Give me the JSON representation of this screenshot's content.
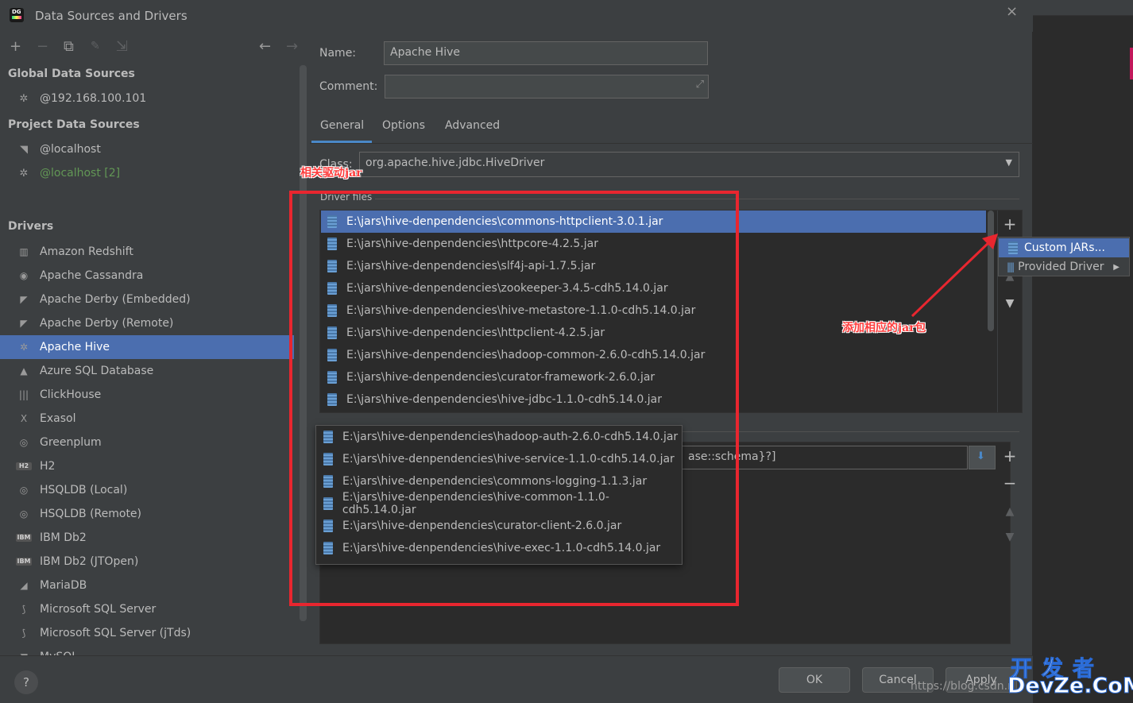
{
  "window": {
    "title": "Data Sources and Drivers",
    "close_label": "×"
  },
  "toolbar": {
    "add": "+",
    "remove": "−",
    "duplicate": "⧉",
    "settings": "🔧",
    "import": "⇲",
    "back": "←",
    "forward": "→"
  },
  "sidebar": {
    "global_title": "Global Data Sources",
    "global_items": [
      {
        "label": "@192.168.100.101",
        "icon": "hive-icon"
      }
    ],
    "project_title": "Project Data Sources",
    "project_items": [
      {
        "label": "@localhost",
        "icon": "mysql-icon"
      },
      {
        "label": "@localhost [2]",
        "icon": "hive-icon"
      }
    ],
    "drivers_title": "Drivers",
    "drivers": [
      {
        "label": "Amazon Redshift",
        "icon_text": "▥"
      },
      {
        "label": "Apache Cassandra",
        "icon_text": "◉"
      },
      {
        "label": "Apache Derby (Embedded)",
        "icon_text": "◤"
      },
      {
        "label": "Apache Derby (Remote)",
        "icon_text": "◤"
      },
      {
        "label": "Apache Hive",
        "icon_text": "✲"
      },
      {
        "label": "Azure SQL Database",
        "icon_text": "▲"
      },
      {
        "label": "ClickHouse",
        "icon_text": "|||"
      },
      {
        "label": "Exasol",
        "icon_text": "X"
      },
      {
        "label": "Greenplum",
        "icon_text": "◎"
      },
      {
        "label": "H2",
        "icon_text": "H2"
      },
      {
        "label": "HSQLDB (Local)",
        "icon_text": "◎"
      },
      {
        "label": "HSQLDB (Remote)",
        "icon_text": "◎"
      },
      {
        "label": "IBM Db2",
        "icon_text": "IBM"
      },
      {
        "label": "IBM Db2 (JTOpen)",
        "icon_text": "IBM"
      },
      {
        "label": "MariaDB",
        "icon_text": "◢"
      },
      {
        "label": "Microsoft SQL Server",
        "icon_text": "⟆"
      },
      {
        "label": "Microsoft SQL Server (jTds)",
        "icon_text": "⟆"
      },
      {
        "label": "MySQL",
        "icon_text": "◥"
      }
    ],
    "selected_driver": "Apache Hive"
  },
  "form": {
    "name_label": "Name:",
    "name_value": "Apache Hive",
    "comment_label": "Comment:",
    "comment_value": "",
    "tabs": [
      {
        "label": "General"
      },
      {
        "label": "Options"
      },
      {
        "label": "Advanced"
      }
    ],
    "class_label": "Class:",
    "class_value": "org.apache.hive.jdbc.HiveDriver",
    "driver_files_label": "Driver files",
    "url_template_tail": "ase::schema}?]"
  },
  "driver_files": [
    "E:\\jars\\hive-denpendencies\\commons-httpclient-3.0.1.jar",
    "E:\\jars\\hive-denpendencies\\httpcore-4.2.5.jar",
    "E:\\jars\\hive-denpendencies\\slf4j-api-1.7.5.jar",
    "E:\\jars\\hive-denpendencies\\zookeeper-3.4.5-cdh5.14.0.jar",
    "E:\\jars\\hive-denpendencies\\hive-metastore-1.1.0-cdh5.14.0.jar",
    "E:\\jars\\hive-denpendencies\\httpclient-4.2.5.jar",
    "E:\\jars\\hive-denpendencies\\hadoop-common-2.6.0-cdh5.14.0.jar",
    "E:\\jars\\hive-denpendencies\\curator-framework-2.6.0.jar",
    "E:\\jars\\hive-denpendencies\\hive-jdbc-1.1.0-cdh5.14.0.jar"
  ],
  "popup_files": [
    "E:\\jars\\hive-denpendencies\\hadoop-auth-2.6.0-cdh5.14.0.jar",
    "E:\\jars\\hive-denpendencies\\hive-service-1.1.0-cdh5.14.0.jar",
    "E:\\jars\\hive-denpendencies\\commons-logging-1.1.3.jar",
    "E:\\jars\\hive-denpendencies\\hive-common-1.1.0-cdh5.14.0.jar",
    "E:\\jars\\hive-denpendencies\\curator-client-2.6.0.jar",
    "E:\\jars\\hive-denpendencies\\hive-exec-1.1.0-cdh5.14.0.jar"
  ],
  "context_menu": {
    "items": [
      {
        "label": "Custom JARs..."
      },
      {
        "label": "Provided Driver"
      }
    ]
  },
  "buttons": {
    "ok": "OK",
    "cancel": "Cancel",
    "apply": "Apply",
    "help": "?"
  },
  "annotations": {
    "related_jars": "相关驱动jar",
    "add_jars": "添加相应的jar包"
  },
  "overlay": {
    "url_text": "https://blog.csdn.n",
    "watermark_line1": "开发者",
    "watermark_line2": "DevZe.CoM"
  },
  "colors": {
    "selection": "#4b6eaf",
    "annotation_red": "#e8262f",
    "tab_underline": "#4a88c7"
  }
}
